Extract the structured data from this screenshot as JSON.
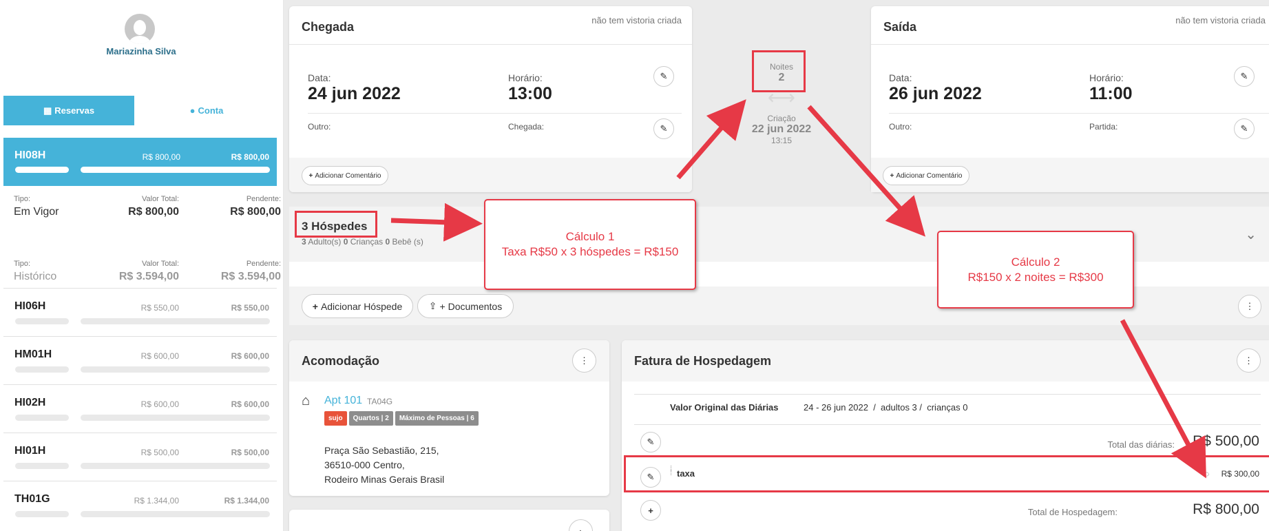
{
  "user": {
    "name": "Mariazinha Silva"
  },
  "tabs": {
    "reservas": "Reservas",
    "conta": "Conta"
  },
  "active_reservation": {
    "code": "HI08H",
    "total": "R$ 800,00",
    "pending": "R$ 800,00"
  },
  "summary": [
    {
      "type_label": "Tipo:",
      "type": "Em Vigor",
      "total_label": "Valor Total:",
      "total": "R$ 800,00",
      "pending_label": "Pendente:",
      "pending": "R$ 800,00"
    },
    {
      "type_label": "Tipo:",
      "type": "Histórico",
      "total_label": "Valor Total:",
      "total": "R$ 3.594,00",
      "pending_label": "Pendente:",
      "pending": "R$ 3.594,00"
    }
  ],
  "reservations": [
    {
      "code": "HI06H",
      "total": "R$ 550,00",
      "pending": "R$ 550,00"
    },
    {
      "code": "HM01H",
      "total": "R$ 600,00",
      "pending": "R$ 600,00"
    },
    {
      "code": "HI02H",
      "total": "R$ 600,00",
      "pending": "R$ 600,00"
    },
    {
      "code": "HI01H",
      "total": "R$ 500,00",
      "pending": "R$ 500,00"
    },
    {
      "code": "TH01G",
      "total": "R$ 1.344,00",
      "pending": "R$ 1.344,00"
    }
  ],
  "arrival": {
    "title": "Chegada",
    "inspection": "não tem vistoria criada",
    "date_label": "Data:",
    "date": "24 jun 2022",
    "time_label": "Horário:",
    "time": "13:00",
    "other_label": "Outro:",
    "extra_label": "Chegada:",
    "comment_btn": "Adicionar Comentário"
  },
  "departure": {
    "title": "Saída",
    "inspection": "não tem vistoria criada",
    "date_label": "Data:",
    "date": "26 jun 2022",
    "time_label": "Horário:",
    "time": "11:00",
    "other_label": "Outro:",
    "extra_label": "Partida:",
    "comment_btn": "Adicionar Comentário"
  },
  "stay": {
    "nights_label": "Noites",
    "nights": "2",
    "created_label": "Criação",
    "created_date": "22 jun 2022",
    "created_time": "13:15"
  },
  "guests": {
    "title": "3 Hóspedes",
    "adults": "3",
    "adults_label": "Adulto(s)",
    "children": "0",
    "children_label": "Crianças",
    "babies": "0",
    "babies_label": "Bebê (s)",
    "add_btn": "Adicionar Hóspede",
    "docs_btn": "+ Documentos"
  },
  "accommodation": {
    "title": "Acomodação",
    "name": "Apt 101",
    "code": "TA04G",
    "badges": [
      {
        "text": "sujo",
        "color": "#e8533a"
      },
      {
        "text": "Quartos | 2",
        "color": "#8d8d8d"
      },
      {
        "text": "Máximo de Pessoas | 6",
        "color": "#8d8d8d"
      }
    ],
    "address": [
      "Praça São Sebastião, 215,",
      "36510-000 Centro,",
      "Rodeiro Minas Gerais Brasil"
    ]
  },
  "invoice": {
    "title": "Fatura de Hospedagem",
    "original_label": "Valor Original das Diárias",
    "original_detail": "24 - 26 jun 2022  /  adultos 3 /  crianças 0",
    "daily_total_label": "Total das diárias:",
    "daily_total": "R$ 500,00",
    "fee_name": "taxa",
    "fee_value": "R$ 300,00",
    "grand_total_label": "Total de Hospedagem:",
    "grand_total": "R$ 800,00"
  },
  "annotations": {
    "calc1_title": "Cálculo 1",
    "calc1_text": "Taxa R$50 x 3 hóspedes = R$150",
    "calc2_title": "Cálculo 2",
    "calc2_text": "R$150 x 2 noites = R$300"
  },
  "colors": {
    "accent": "#45b3d9",
    "annotation": "#e63946",
    "dirty": "#e8533a"
  }
}
